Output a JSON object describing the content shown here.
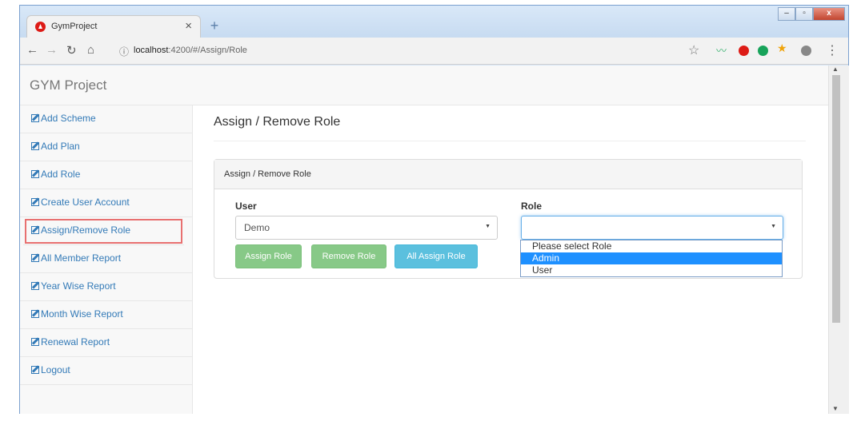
{
  "browser": {
    "tab_title": "GymProject",
    "tab_close": "×",
    "new_tab": "+",
    "url_host": "localhost",
    "url_path": ":4200/#/Assign/Role",
    "window_controls": [
      "–",
      "▫",
      "x"
    ]
  },
  "navbar": {
    "brand": "GYM Project"
  },
  "sidebar": {
    "items": [
      {
        "label": "Add Scheme"
      },
      {
        "label": "Add Plan"
      },
      {
        "label": "Add Role"
      },
      {
        "label": "Create User Account"
      },
      {
        "label": "Assign/Remove Role"
      },
      {
        "label": "All Member Report"
      },
      {
        "label": "Year Wise Report"
      },
      {
        "label": "Month Wise Report"
      },
      {
        "label": "Renewal Report"
      },
      {
        "label": "Logout"
      }
    ],
    "active_item": "Assign/Remove Role",
    "active_outline_color": "#e87070"
  },
  "main": {
    "page_title": "Assign / Remove Role",
    "panel_heading": "Assign / Remove Role",
    "user_label": "User",
    "user_value": "Demo",
    "role_label": "Role",
    "role_value": "",
    "buttons": {
      "assign": "Assign Role",
      "remove": "Remove Role",
      "all_assign": "All Assign Role"
    },
    "role_options": [
      "Please select Role",
      "Admin",
      "User"
    ],
    "role_highlighted_option": "Admin"
  },
  "colors": {
    "link": "#337ab7",
    "success_button": "#87c987",
    "info_button": "#5bc0de",
    "selected_option": "#1e90ff"
  }
}
